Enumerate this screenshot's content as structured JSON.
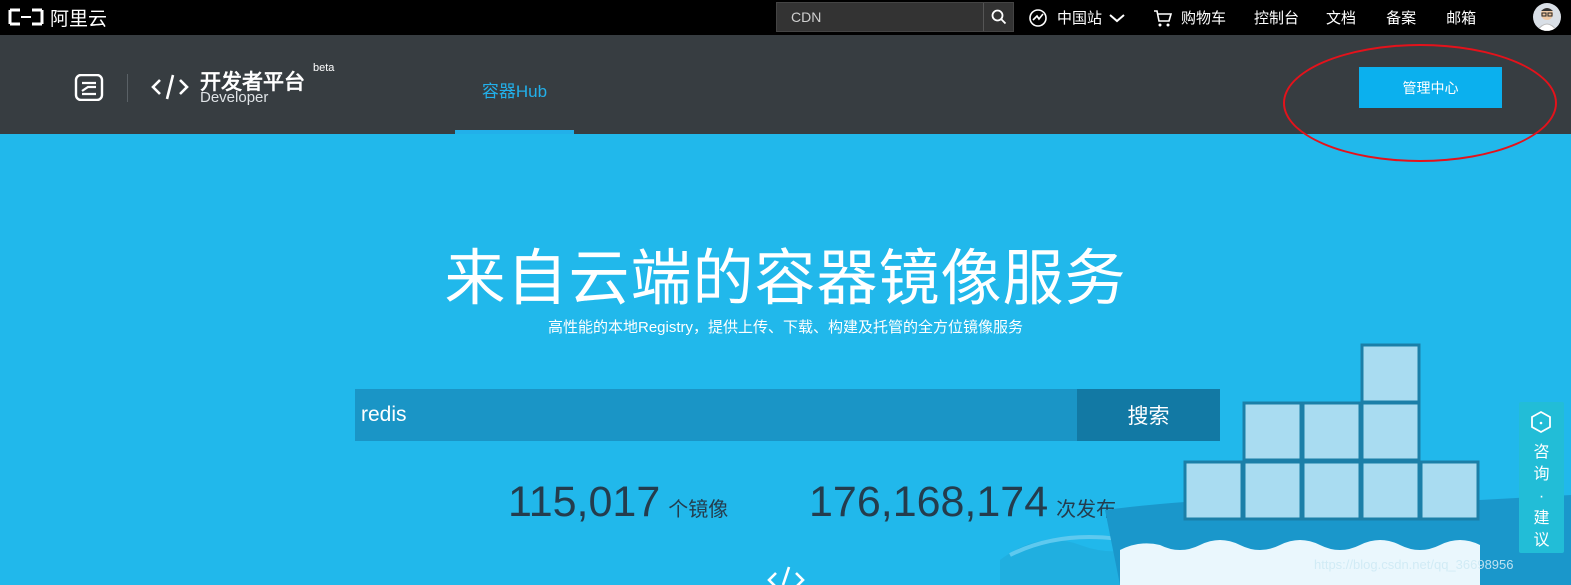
{
  "topbar": {
    "logo_text": "阿里云",
    "search_value": "CDN",
    "nav": [
      {
        "label": "中国站",
        "icon": "globe-icon"
      },
      {
        "label": "购物车",
        "icon": "cart-icon"
      },
      {
        "label": "控制台"
      },
      {
        "label": "文档"
      },
      {
        "label": "备案"
      },
      {
        "label": "邮箱"
      }
    ]
  },
  "header": {
    "brand_title": "开发者平台",
    "brand_beta": "beta",
    "brand_sub": "Developer",
    "tab_label": "容器Hub",
    "mgmt_button": "管理中心"
  },
  "hero": {
    "title": "来自云端的容器镜像服务",
    "subtitle": "高性能的本地Registry，提供上传、下载、构建及托管的全方位镜像服务",
    "search_value": "redis",
    "search_button": "搜索",
    "stats": [
      {
        "value": "115,017",
        "label": "个镜像"
      },
      {
        "value": "176,168,174",
        "label": "次发布"
      }
    ]
  },
  "side_float": {
    "label_1": "咨",
    "label_2": "询",
    "separator": "·",
    "label_3": "建",
    "label_4": "议"
  },
  "watermark": "https://blog.csdn.net/qq_36698956",
  "colors": {
    "topbar_bg": "#000000",
    "header_bg": "#373d41",
    "hero_bg": "#21b8eb",
    "accent": "#0bb0ee",
    "annotation": "#e4121b"
  }
}
